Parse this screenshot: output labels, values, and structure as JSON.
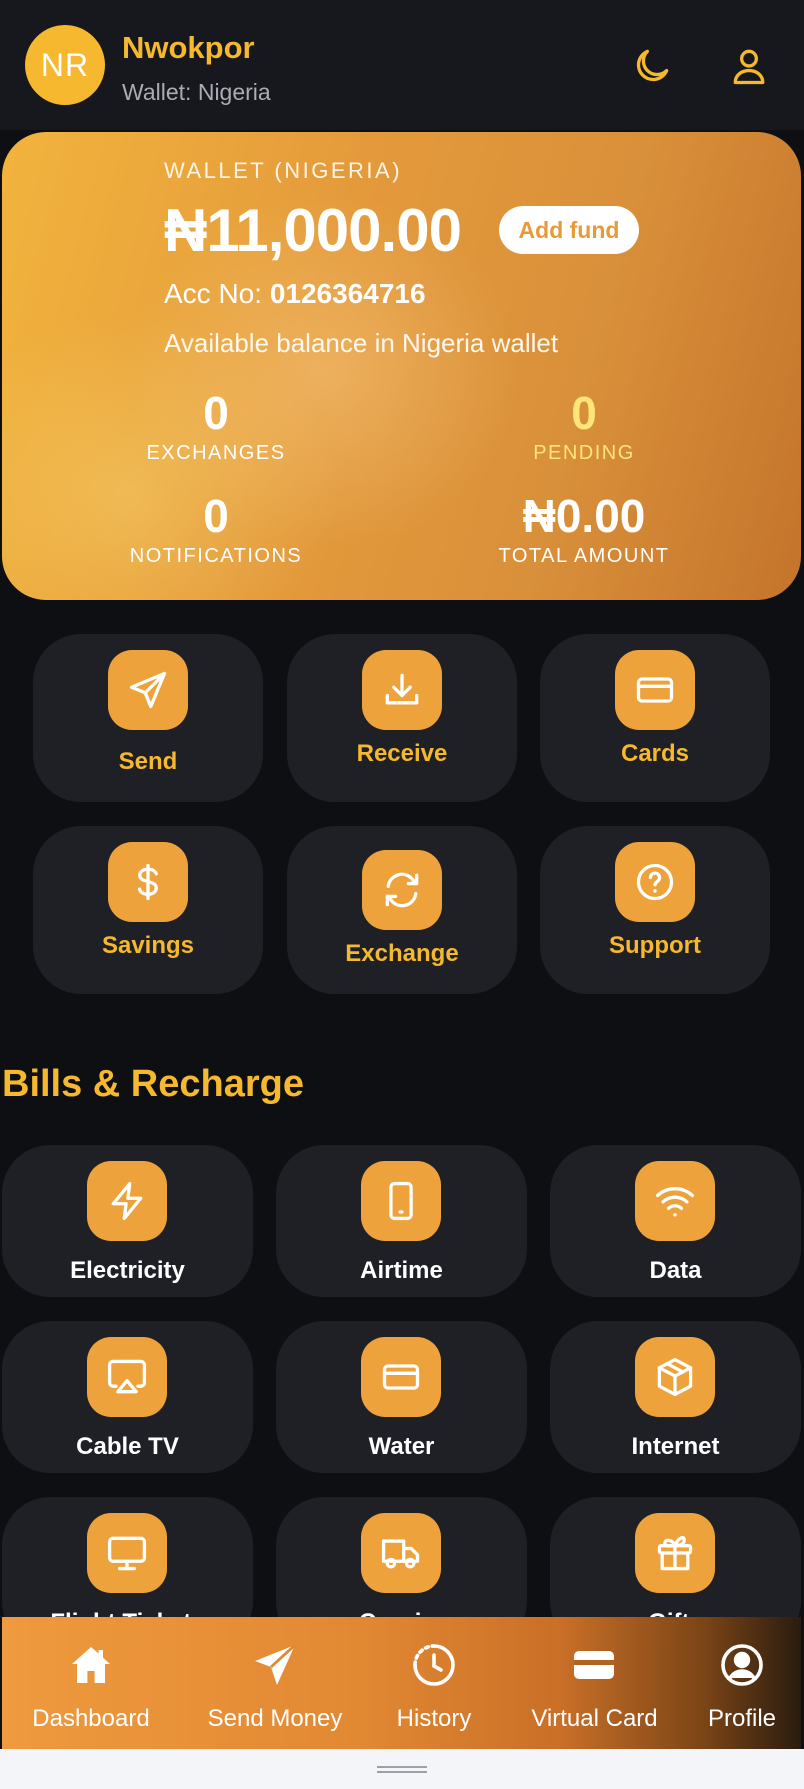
{
  "header": {
    "avatar_initials": "NR",
    "user_name": "Nwokpor",
    "wallet_label": "Wallet: Nigeria",
    "accent_color": "#f5b82e"
  },
  "wallet": {
    "title": "WALLET (NIGERIA)",
    "balance": "₦11,000.00",
    "add_fund_label": "Add fund",
    "acc_prefix": "Acc No:",
    "acc_number": "0126364716",
    "available_text": "Available balance in Nigeria wallet",
    "stats": {
      "exchanges": {
        "value": "0",
        "label": "EXCHANGES"
      },
      "pending": {
        "value": "0",
        "label": "PENDING"
      },
      "notifications": {
        "value": "0",
        "label": "NOTIFICATIONS"
      },
      "total": {
        "value": "₦0.00",
        "label": "TOTAL AMOUNT"
      }
    }
  },
  "actions": [
    {
      "label": "Send",
      "icon": "send-icon"
    },
    {
      "label": "Receive",
      "icon": "download-icon"
    },
    {
      "label": "Cards",
      "icon": "card-icon"
    },
    {
      "label": "Savings",
      "icon": "dollar-icon"
    },
    {
      "label": "Exchange",
      "icon": "refresh-icon"
    },
    {
      "label": "Support",
      "icon": "help-icon"
    }
  ],
  "bills": {
    "title": "Bills & Recharge",
    "items": [
      {
        "label": "Electricity",
        "icon": "bolt-icon"
      },
      {
        "label": "Airtime",
        "icon": "phone-icon"
      },
      {
        "label": "Data",
        "icon": "wifi-icon"
      },
      {
        "label": "Cable TV",
        "icon": "airplay-icon"
      },
      {
        "label": "Water",
        "icon": "card-icon"
      },
      {
        "label": "Internet",
        "icon": "box-icon"
      },
      {
        "label": "Flight Tickets",
        "icon": "monitor-icon"
      },
      {
        "label": "Courier",
        "icon": "truck-icon"
      },
      {
        "label": "Gifts",
        "icon": "gift-icon"
      }
    ]
  },
  "nav": {
    "items": [
      {
        "label": "Dashboard",
        "icon": "home-icon"
      },
      {
        "label": "Send Money",
        "icon": "send-icon"
      },
      {
        "label": "History",
        "icon": "clock-icon"
      },
      {
        "label": "Virtual Card",
        "icon": "credit-card-icon"
      },
      {
        "label": "Profile",
        "icon": "user-circle-icon"
      }
    ]
  }
}
